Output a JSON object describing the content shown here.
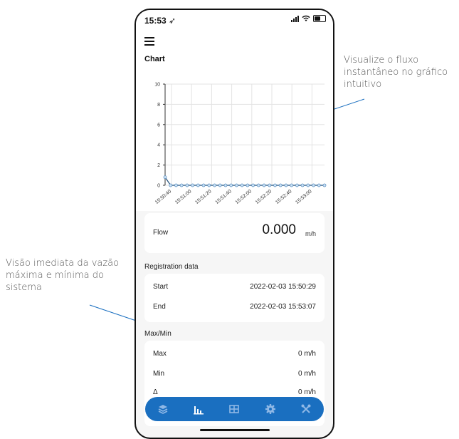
{
  "annotations": {
    "chart_note": "Visualize o fluxo instantâneo no gráfico intuitivo",
    "minmax_note": "Visão imediata da vazão máxima e mínima do sistema"
  },
  "status_bar": {
    "time": "15:53"
  },
  "header": {
    "title": "Chart"
  },
  "chart_data": {
    "type": "line",
    "x": [
      "15:50:40",
      "15:51:00",
      "15:51:20",
      "15:51:40",
      "15:52:00",
      "15:52:20",
      "15:52:40",
      "15:53:00"
    ],
    "y_ticks": [
      0,
      2,
      4,
      6,
      8,
      10
    ],
    "ylim": [
      0,
      10
    ],
    "point_count": 30,
    "values": [
      0.8,
      0,
      0,
      0,
      0,
      0,
      0,
      0,
      0,
      0,
      0,
      0,
      0,
      0,
      0,
      0,
      0,
      0,
      0,
      0,
      0,
      0,
      0,
      0,
      0,
      0,
      0,
      0,
      0,
      0
    ],
    "series_color": "#1f4e79",
    "grid": true,
    "title": "",
    "xlabel": "",
    "ylabel": ""
  },
  "flow": {
    "label": "Flow",
    "value": "0.000",
    "unit": "m/h"
  },
  "registration": {
    "section_label": "Registration data",
    "rows": [
      {
        "label": "Start",
        "value": "2022-02-03 15:50:29"
      },
      {
        "label": "End",
        "value": "2022-02-03 15:53:07"
      }
    ]
  },
  "maxmin": {
    "section_label": "Max/Min",
    "rows": [
      {
        "label": "Max",
        "value": "0 m/h"
      },
      {
        "label": "Min",
        "value": "0 m/h"
      },
      {
        "label": "Δ",
        "value": "0 m/h"
      }
    ]
  },
  "tabbar": {
    "color": "#1a6fc0",
    "tabs": [
      {
        "icon": "layers-icon"
      },
      {
        "icon": "bar-chart-icon",
        "active": true
      },
      {
        "icon": "table-icon"
      },
      {
        "icon": "gear-icon"
      },
      {
        "icon": "tools-icon"
      }
    ]
  }
}
